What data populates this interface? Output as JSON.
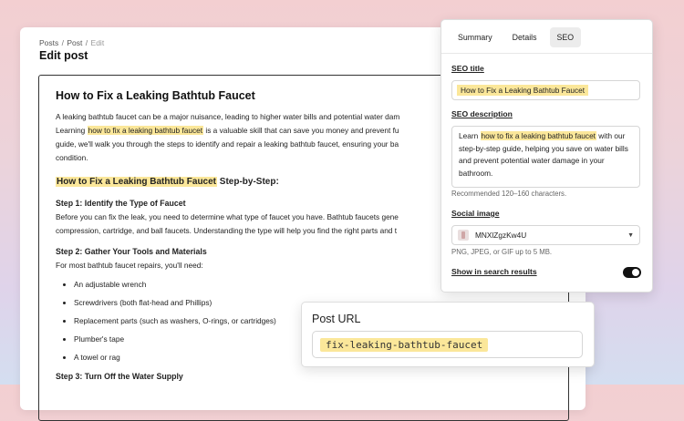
{
  "breadcrumb": {
    "posts": "Posts",
    "sep": "/",
    "post": "Post",
    "current": "Edit"
  },
  "page_title": "Edit post",
  "article": {
    "title": "How to Fix a Leaking Bathtub Faucet",
    "intro": {
      "p1": "A leaking bathtub faucet can be a major nuisance, leading to higher water bills and potential water dam",
      "p2": "Learning ",
      "hl": "how to fix a leaking bathtub faucet",
      "p3": " is a valuable skill that can save you money and prevent fu",
      "p4": "guide, we'll walk you through the steps to identify and repair a leaking bathtub faucet, ensuring your ba",
      "p5": "condition."
    },
    "heading": {
      "hl": "How to Fix a Leaking Bathtub Faucet",
      "rest": " Step-by-Step:"
    },
    "step1": {
      "title": "Step 1: Identify the Type of Faucet",
      "l1": "Before you can fix the leak, you need to determine what type of faucet you have. Bathtub faucets gene",
      "l2": "compression, cartridge, and ball faucets. Understanding the type will help you find the right parts and t"
    },
    "step2": {
      "title": "Step 2: Gather Your Tools and Materials",
      "intro": "For most bathtub faucet repairs, you'll need:",
      "items": [
        "An adjustable wrench",
        "Screwdrivers (both flat-head and Phillips)",
        "Replacement parts (such as washers, O-rings, or cartridges)",
        "Plumber's tape",
        "A towel or rag"
      ]
    },
    "step3": {
      "title": "Step 3: Turn Off the Water Supply"
    }
  },
  "seo_panel": {
    "tabs": [
      "Summary",
      "Details",
      "SEO"
    ],
    "active_tab": "SEO",
    "seo_title_label": "SEO title",
    "seo_title_value": "How to Fix a Leaking Bathtub Faucet",
    "seo_desc_label": "SEO description",
    "seo_desc": {
      "pre": "Learn ",
      "hl": "how to fix a leaking bathtub faucet",
      "post": " with our step-by-step guide, helping you save on water bills and prevent potential water damage in your bathroom."
    },
    "seo_desc_helper": "Recommended 120–160 characters.",
    "social_label": "Social image",
    "social_value": "MNXlZgzKw4U",
    "social_helper": "PNG, JPEG, or GIF up to 5 MB.",
    "search_label": "Show in search results",
    "search_on": true
  },
  "post_url": {
    "label": "Post URL",
    "value": "fix-leaking-bathtub-faucet"
  },
  "colors": {
    "highlight": "#fbe79a",
    "toggle": "#111111"
  },
  "icons": {
    "select_caret": "chevron-down-icon",
    "image_thumb": "image-thumbnail-icon"
  }
}
